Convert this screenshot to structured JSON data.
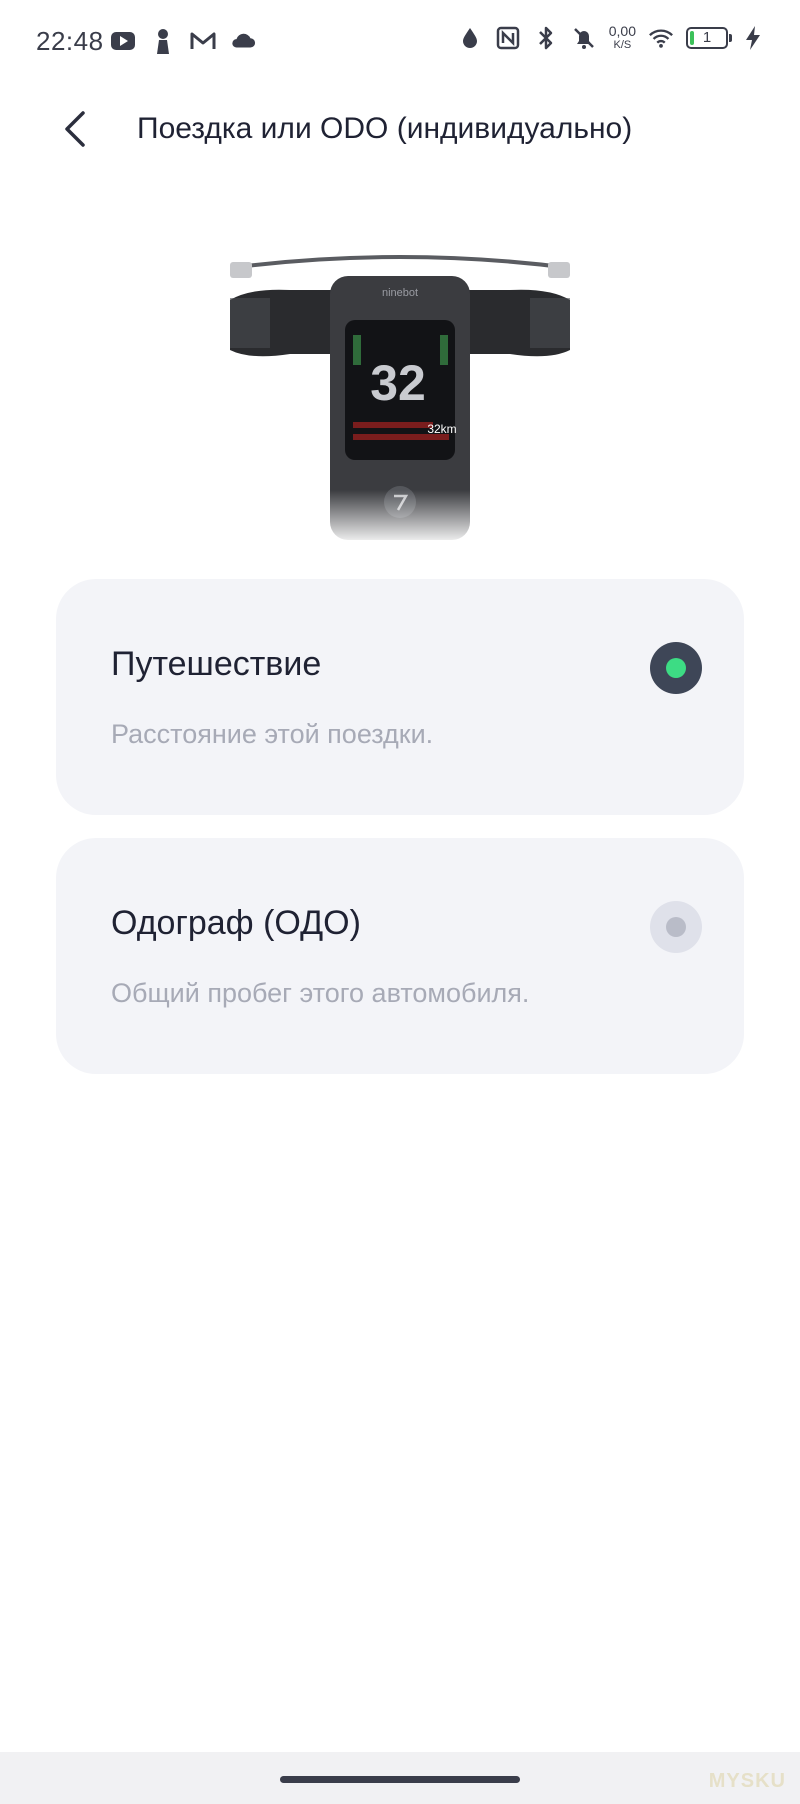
{
  "status_bar": {
    "time": "22:48",
    "net_speed_value": "0,00",
    "net_speed_unit": "K/S",
    "battery_level": "1",
    "left_icons": [
      "youtube-icon",
      "notification-person-icon",
      "gmail-icon",
      "cloud-icon"
    ],
    "right_icons": [
      "data-saver-icon",
      "nfc-icon",
      "bluetooth-icon",
      "mute-bell-icon",
      "wifi-icon",
      "charging-icon"
    ]
  },
  "header": {
    "title": "Поездка или ODO (индивидуально)",
    "back_icon": "chevron-left-icon"
  },
  "illustration": {
    "brand": "ninebot",
    "speed": "32",
    "distance": "32km"
  },
  "options": [
    {
      "title": "Путешествие",
      "description": "Расстояние этой поездки.",
      "selected": true
    },
    {
      "title": "Одограф (ОДО)",
      "description": "Общий пробег этого автомобиля.",
      "selected": false
    }
  ],
  "colors": {
    "accent_green": "#3ddc84",
    "card_bg": "#f3f4f8",
    "text_primary": "#1f2233",
    "text_secondary": "#a7aab6"
  },
  "watermark": "MYSKU"
}
